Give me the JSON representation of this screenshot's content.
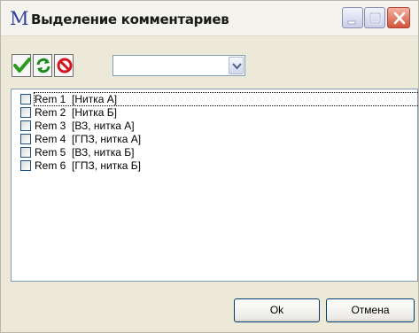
{
  "window": {
    "icon_letter": "M",
    "title": "Выделение комментариев"
  },
  "toolbar": {
    "buttons": [
      {
        "icon": "check-icon"
      },
      {
        "icon": "refresh-icon"
      },
      {
        "icon": "no-entry-icon"
      }
    ]
  },
  "filter_combo": {
    "value": ""
  },
  "comments": {
    "items": [
      {
        "label": "Rem 1  [Нитка А]",
        "checked": false
      },
      {
        "label": "Rem 2  [Нитка Б]",
        "checked": false
      },
      {
        "label": "Rem 3  [ВЗ, нитка А]",
        "checked": false
      },
      {
        "label": "Rem 4  [ГПЗ, нитка А]",
        "checked": false
      },
      {
        "label": "Rem 5  [ВЗ, нитка Б]",
        "checked": false
      },
      {
        "label": "Rem 6  [ГПЗ, нитка Б]",
        "checked": false
      }
    ]
  },
  "buttons": {
    "ok_label": "Ok",
    "cancel_label": "Отмена"
  },
  "colors": {
    "close_button": "#d4533a",
    "check_icon": "#2a9a1c",
    "refresh_icon": "#1f8a1f",
    "stop_icon": "#d0161c"
  }
}
